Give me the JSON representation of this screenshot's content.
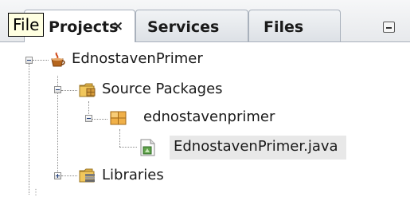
{
  "tabs": [
    {
      "label": "Projects",
      "close": "×",
      "active": true
    },
    {
      "label": "Services",
      "active": false
    },
    {
      "label": "Files",
      "active": false
    }
  ],
  "tooltip": "File",
  "tree": {
    "project": "EdnostavenPrimer",
    "source_packages": "Source Packages",
    "package": "ednostavenprimer",
    "file": "EdnostavenPrimer.java",
    "libraries": "Libraries"
  },
  "icons": {
    "project": "coffee-cup-icon",
    "source_packages": "package-folder-icon",
    "package": "package-icon",
    "file": "java-file-icon",
    "libraries": "library-folder-icon",
    "minimize": "minimize-icon"
  }
}
